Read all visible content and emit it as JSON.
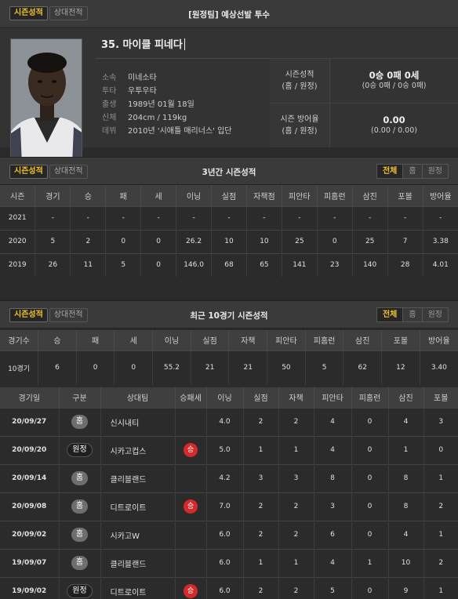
{
  "top_tabs": [
    "시즌성적",
    "상대전적"
  ],
  "header_title": "[원정팀] 예상선발 투수",
  "player": {
    "name": "35. 마이클 피네다",
    "info": [
      {
        "k": "소속",
        "v": "미네소타"
      },
      {
        "k": "투타",
        "v": "우투우타"
      },
      {
        "k": "출생",
        "v": "1989년 01월 18일"
      },
      {
        "k": "신체",
        "v": "204cm / 119kg"
      },
      {
        "k": "데뷔",
        "v": "2010년 '시애틀 매리너스' 입단"
      }
    ],
    "season_label_1": "시즌성적",
    "season_label_2": "(홈 / 원정)",
    "season_value": "0승 0패 0세",
    "season_split": "(0승 0패 / 0승 0패)",
    "era_label_1": "시즌 방어율",
    "era_label_2": "(홈 / 원정)",
    "era_value": "0.00",
    "era_split": "(0.00 / 0.00)"
  },
  "filters": [
    "전체",
    "홈",
    "원정"
  ],
  "section1": {
    "tabs": [
      "시즌성적",
      "상대전적"
    ],
    "title": "3년간 시즌성적",
    "headers": [
      "시즌",
      "경기",
      "승",
      "패",
      "세",
      "이닝",
      "실점",
      "자책점",
      "피안타",
      "피홈런",
      "삼진",
      "포볼",
      "방어율"
    ],
    "rows": [
      [
        "2021",
        "-",
        "-",
        "-",
        "-",
        "-",
        "-",
        "-",
        "-",
        "-",
        "-",
        "-",
        "-"
      ],
      [
        "2020",
        "5",
        "2",
        "0",
        "0",
        "26.2",
        "10",
        "10",
        "25",
        "0",
        "25",
        "7",
        "3.38"
      ],
      [
        "2019",
        "26",
        "11",
        "5",
        "0",
        "146.0",
        "68",
        "65",
        "141",
        "23",
        "140",
        "28",
        "4.01"
      ]
    ]
  },
  "section2": {
    "tabs": [
      "시즌성적",
      "상대전적"
    ],
    "title": "최근 10경기 시즌성적",
    "headers": [
      "경기수",
      "승",
      "패",
      "세",
      "이닝",
      "실점",
      "자책",
      "피안타",
      "피홈런",
      "삼진",
      "포볼",
      "방어율"
    ],
    "row": [
      "10경기",
      "6",
      "0",
      "0",
      "55.2",
      "21",
      "21",
      "50",
      "5",
      "62",
      "12",
      "3.40"
    ]
  },
  "section3": {
    "headers": [
      "경기일",
      "구분",
      "상대팀",
      "승패세",
      "이닝",
      "실점",
      "자책",
      "피안타",
      "피홈런",
      "삼진",
      "포볼"
    ],
    "rows": [
      {
        "date": "20/09/27",
        "loc": "홈",
        "team": "신시내티",
        "result": "",
        "ip": "4.0",
        "r": "2",
        "er": "2",
        "h": "4",
        "hr": "0",
        "so": "4",
        "bb": "3"
      },
      {
        "date": "20/09/20",
        "loc": "원정",
        "team": "시카고컵스",
        "result": "승",
        "ip": "5.0",
        "r": "1",
        "er": "1",
        "h": "4",
        "hr": "0",
        "so": "1",
        "bb": "0"
      },
      {
        "date": "20/09/14",
        "loc": "홈",
        "team": "클리블랜드",
        "result": "",
        "ip": "4.2",
        "r": "3",
        "er": "3",
        "h": "8",
        "hr": "0",
        "so": "8",
        "bb": "1"
      },
      {
        "date": "20/09/08",
        "loc": "홈",
        "team": "디트로이트",
        "result": "승",
        "ip": "7.0",
        "r": "2",
        "er": "2",
        "h": "3",
        "hr": "0",
        "so": "8",
        "bb": "2"
      },
      {
        "date": "20/09/02",
        "loc": "홈",
        "team": "시카고W",
        "result": "",
        "ip": "6.0",
        "r": "2",
        "er": "2",
        "h": "6",
        "hr": "0",
        "so": "4",
        "bb": "1"
      },
      {
        "date": "19/09/07",
        "loc": "홈",
        "team": "클리블랜드",
        "result": "",
        "ip": "6.0",
        "r": "1",
        "er": "1",
        "h": "4",
        "hr": "1",
        "so": "10",
        "bb": "2"
      },
      {
        "date": "19/09/02",
        "loc": "원정",
        "team": "디트로이트",
        "result": "승",
        "ip": "6.0",
        "r": "2",
        "er": "2",
        "h": "5",
        "hr": "0",
        "so": "9",
        "bb": "1"
      }
    ]
  }
}
